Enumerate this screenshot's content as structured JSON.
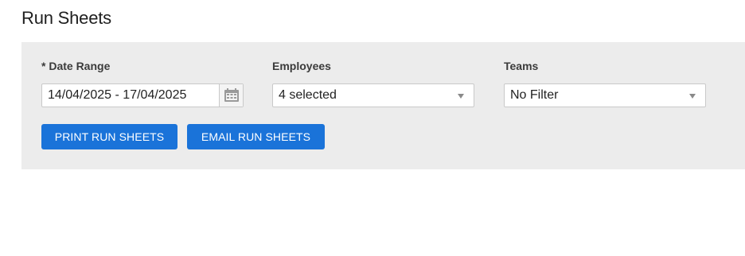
{
  "page": {
    "title": "Run Sheets"
  },
  "filters": {
    "date_range": {
      "label": "* Date Range",
      "value": "14/04/2025 - 17/04/2025",
      "calendar_icon": "calendar-icon"
    },
    "employees": {
      "label": "Employees",
      "selected": "4 selected"
    },
    "teams": {
      "label": "Teams",
      "selected": "No Filter"
    }
  },
  "actions": {
    "print_label": "PRINT RUN SHEETS",
    "email_label": "EMAIL RUN SHEETS"
  },
  "colors": {
    "button": "#1a73d9",
    "panel_background": "#ececec"
  }
}
